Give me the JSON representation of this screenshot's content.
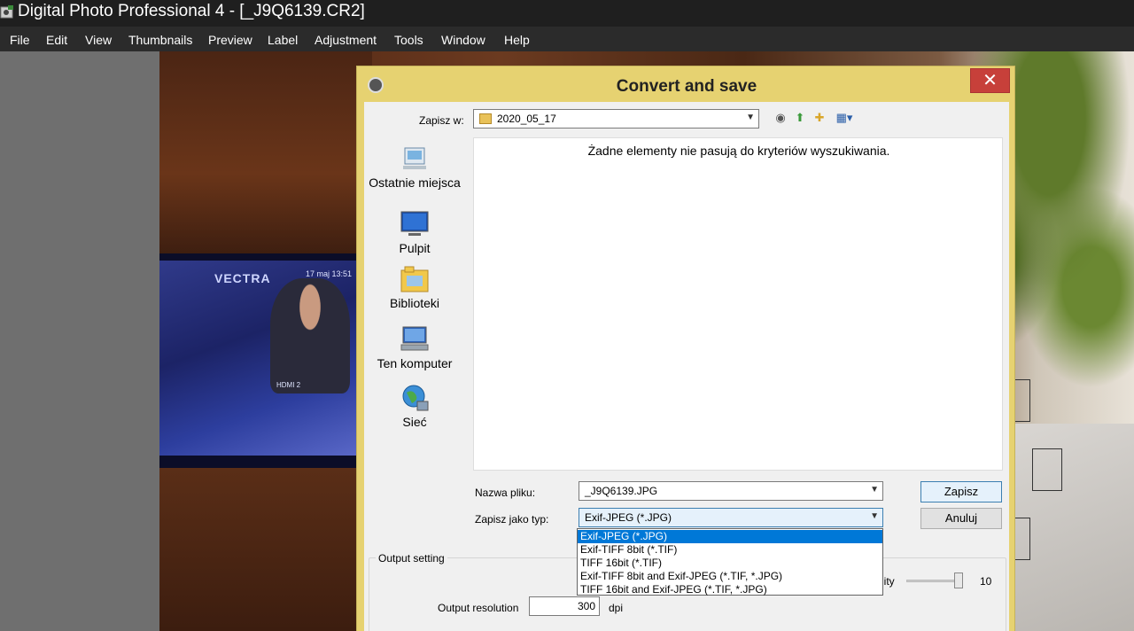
{
  "app": {
    "title": "Digital Photo Professional 4 - [_J9Q6139.CR2]"
  },
  "menu": [
    "File",
    "Edit",
    "View",
    "Thumbnails",
    "Preview",
    "Label",
    "Adjustment",
    "Tools",
    "Window",
    "Help"
  ],
  "photo": {
    "tv_logo": "VECTRA",
    "tv_date": "17 maj  13:51",
    "tv_hdmi": "HDMI 2"
  },
  "dialog": {
    "title": "Convert and save",
    "close": "✕",
    "save_in_label": "Zapisz w:",
    "save_in_value": "2020_05_17",
    "places": [
      "Ostatnie miejsca",
      "Pulpit",
      "Biblioteki",
      "Ten komputer",
      "Sieć"
    ],
    "empty_message": "Żadne elementy nie pasują do kryteriów wyszukiwania.",
    "filename_label": "Nazwa pliku:",
    "filename_value": "_J9Q6139.JPG",
    "filetype_label": "Zapisz jako typ:",
    "filetype_value": "Exif-JPEG (*.JPG)",
    "filetype_options": [
      "Exif-JPEG (*.JPG)",
      "Exif-TIFF 8bit (*.TIF)",
      "TIFF 16bit (*.TIF)",
      "Exif-TIFF 8bit and Exif-JPEG (*.TIF, *.JPG)",
      "TIFF 16bit and Exif-JPEG (*.TIF, *.JPG)"
    ],
    "save_button": "Zapisz",
    "cancel_button": "Anuluj",
    "output_setting_label": "Output setting",
    "quality_label_partial": "lity",
    "quality_value": "10",
    "output_resolution_label": "Output resolution",
    "output_resolution_value": "300",
    "dpi_label": "dpi"
  },
  "colors": {
    "dialog_frame": "#e6d271",
    "close_button": "#c7403a",
    "selection": "#0078d7"
  }
}
